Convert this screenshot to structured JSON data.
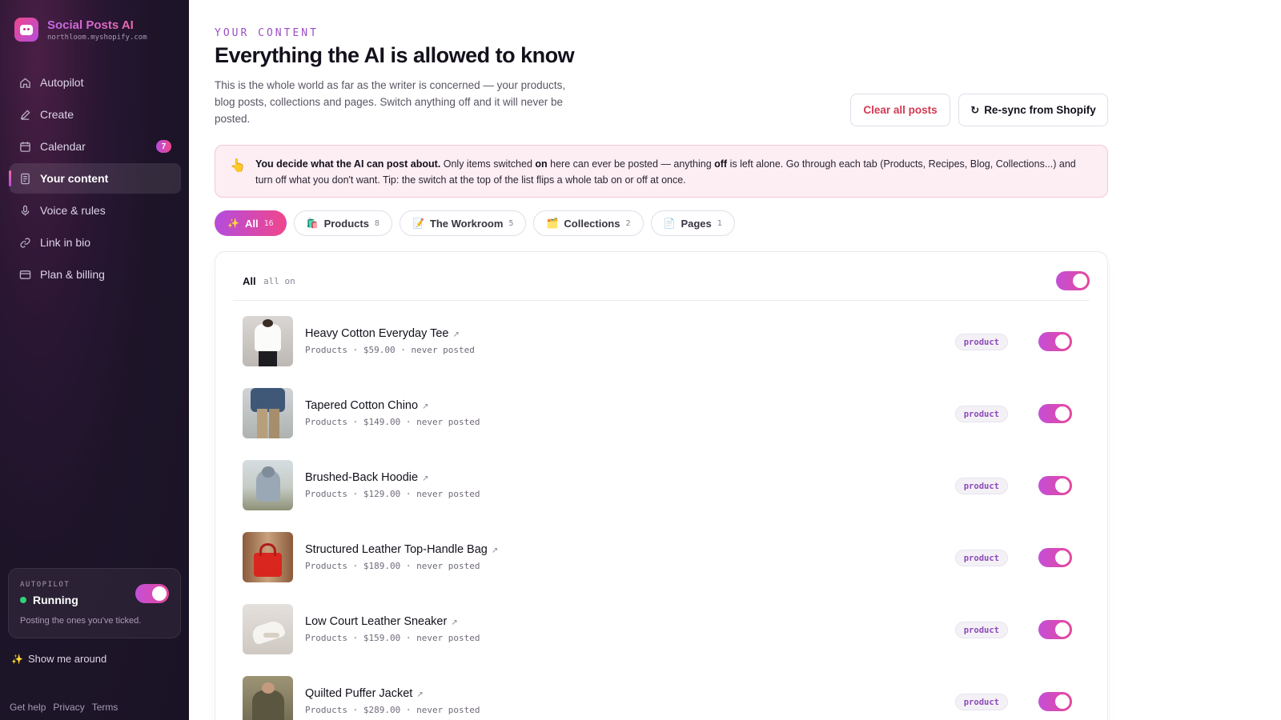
{
  "app": {
    "name": "Social Posts AI",
    "domain": "northloom.myshopify.com"
  },
  "sidebar": {
    "items": [
      {
        "label": "Autopilot",
        "icon": "home-icon"
      },
      {
        "label": "Create",
        "icon": "pencil-icon"
      },
      {
        "label": "Calendar",
        "icon": "calendar-icon",
        "badge": "7"
      },
      {
        "label": "Your content",
        "icon": "document-icon",
        "active": true
      },
      {
        "label": "Voice & rules",
        "icon": "microphone-icon"
      },
      {
        "label": "Link in bio",
        "icon": "link-icon"
      },
      {
        "label": "Plan & billing",
        "icon": "credit-card-icon"
      }
    ],
    "autopilot_card": {
      "kicker": "AUTOPILOT",
      "status": "Running",
      "description": "Posting the ones you've ticked.",
      "enabled": true
    },
    "tour_label": "Show me around",
    "footer_links": [
      "Get help",
      "Privacy",
      "Terms"
    ]
  },
  "header": {
    "kicker": "YOUR CONTENT",
    "title": "Everything the AI is allowed to know",
    "subtitle": "This is the whole world as far as the writer is concerned — your products, blog posts, collections and pages. Switch anything off and it will never be posted.",
    "clear_label": "Clear all posts",
    "sync_label": "Re-sync from Shopify",
    "sync_icon": "↻"
  },
  "notice": {
    "emoji": "👆",
    "lead": "You decide what the AI can post about.",
    "part1": " Only items switched ",
    "on_word": "on",
    "part2": " here can ever be posted — anything ",
    "off_word": "off",
    "part3": " is left alone. Go through each tab (Products, Recipes, Blog, Collections...) and turn off what you don't want. Tip: the switch at the top of the list flips a whole tab on or off at once."
  },
  "tabs": [
    {
      "emoji": "✨",
      "label": "All",
      "count": "16",
      "active": true
    },
    {
      "emoji": "🛍️",
      "label": "Products",
      "count": "8"
    },
    {
      "emoji": "📝",
      "label": "The Workroom",
      "count": "5"
    },
    {
      "emoji": "🗂️",
      "label": "Collections",
      "count": "2"
    },
    {
      "emoji": "📄",
      "label": "Pages",
      "count": "1"
    }
  ],
  "list": {
    "header_label": "All",
    "header_sub": "all on",
    "all_enabled": true,
    "items": [
      {
        "name": "Heavy Cotton Everyday Tee",
        "meta": "Products · $59.00 · never posted",
        "type": "product",
        "enabled": true
      },
      {
        "name": "Tapered Cotton Chino",
        "meta": "Products · $149.00 · never posted",
        "type": "product",
        "enabled": true
      },
      {
        "name": "Brushed-Back Hoodie",
        "meta": "Products · $129.00 · never posted",
        "type": "product",
        "enabled": true
      },
      {
        "name": "Structured Leather Top-Handle Bag",
        "meta": "Products · $189.00 · never posted",
        "type": "product",
        "enabled": true
      },
      {
        "name": "Low Court Leather Sneaker",
        "meta": "Products · $159.00 · never posted",
        "type": "product",
        "enabled": true
      },
      {
        "name": "Quilted Puffer Jacket",
        "meta": "Products · $289.00 · never posted",
        "type": "product",
        "enabled": true
      }
    ]
  },
  "colors": {
    "accent_start": "#b44ddc",
    "accent_end": "#f0468c",
    "danger": "#d23a52",
    "sidebar_bg": "#1d1428",
    "notice_bg": "#fdeef4"
  }
}
